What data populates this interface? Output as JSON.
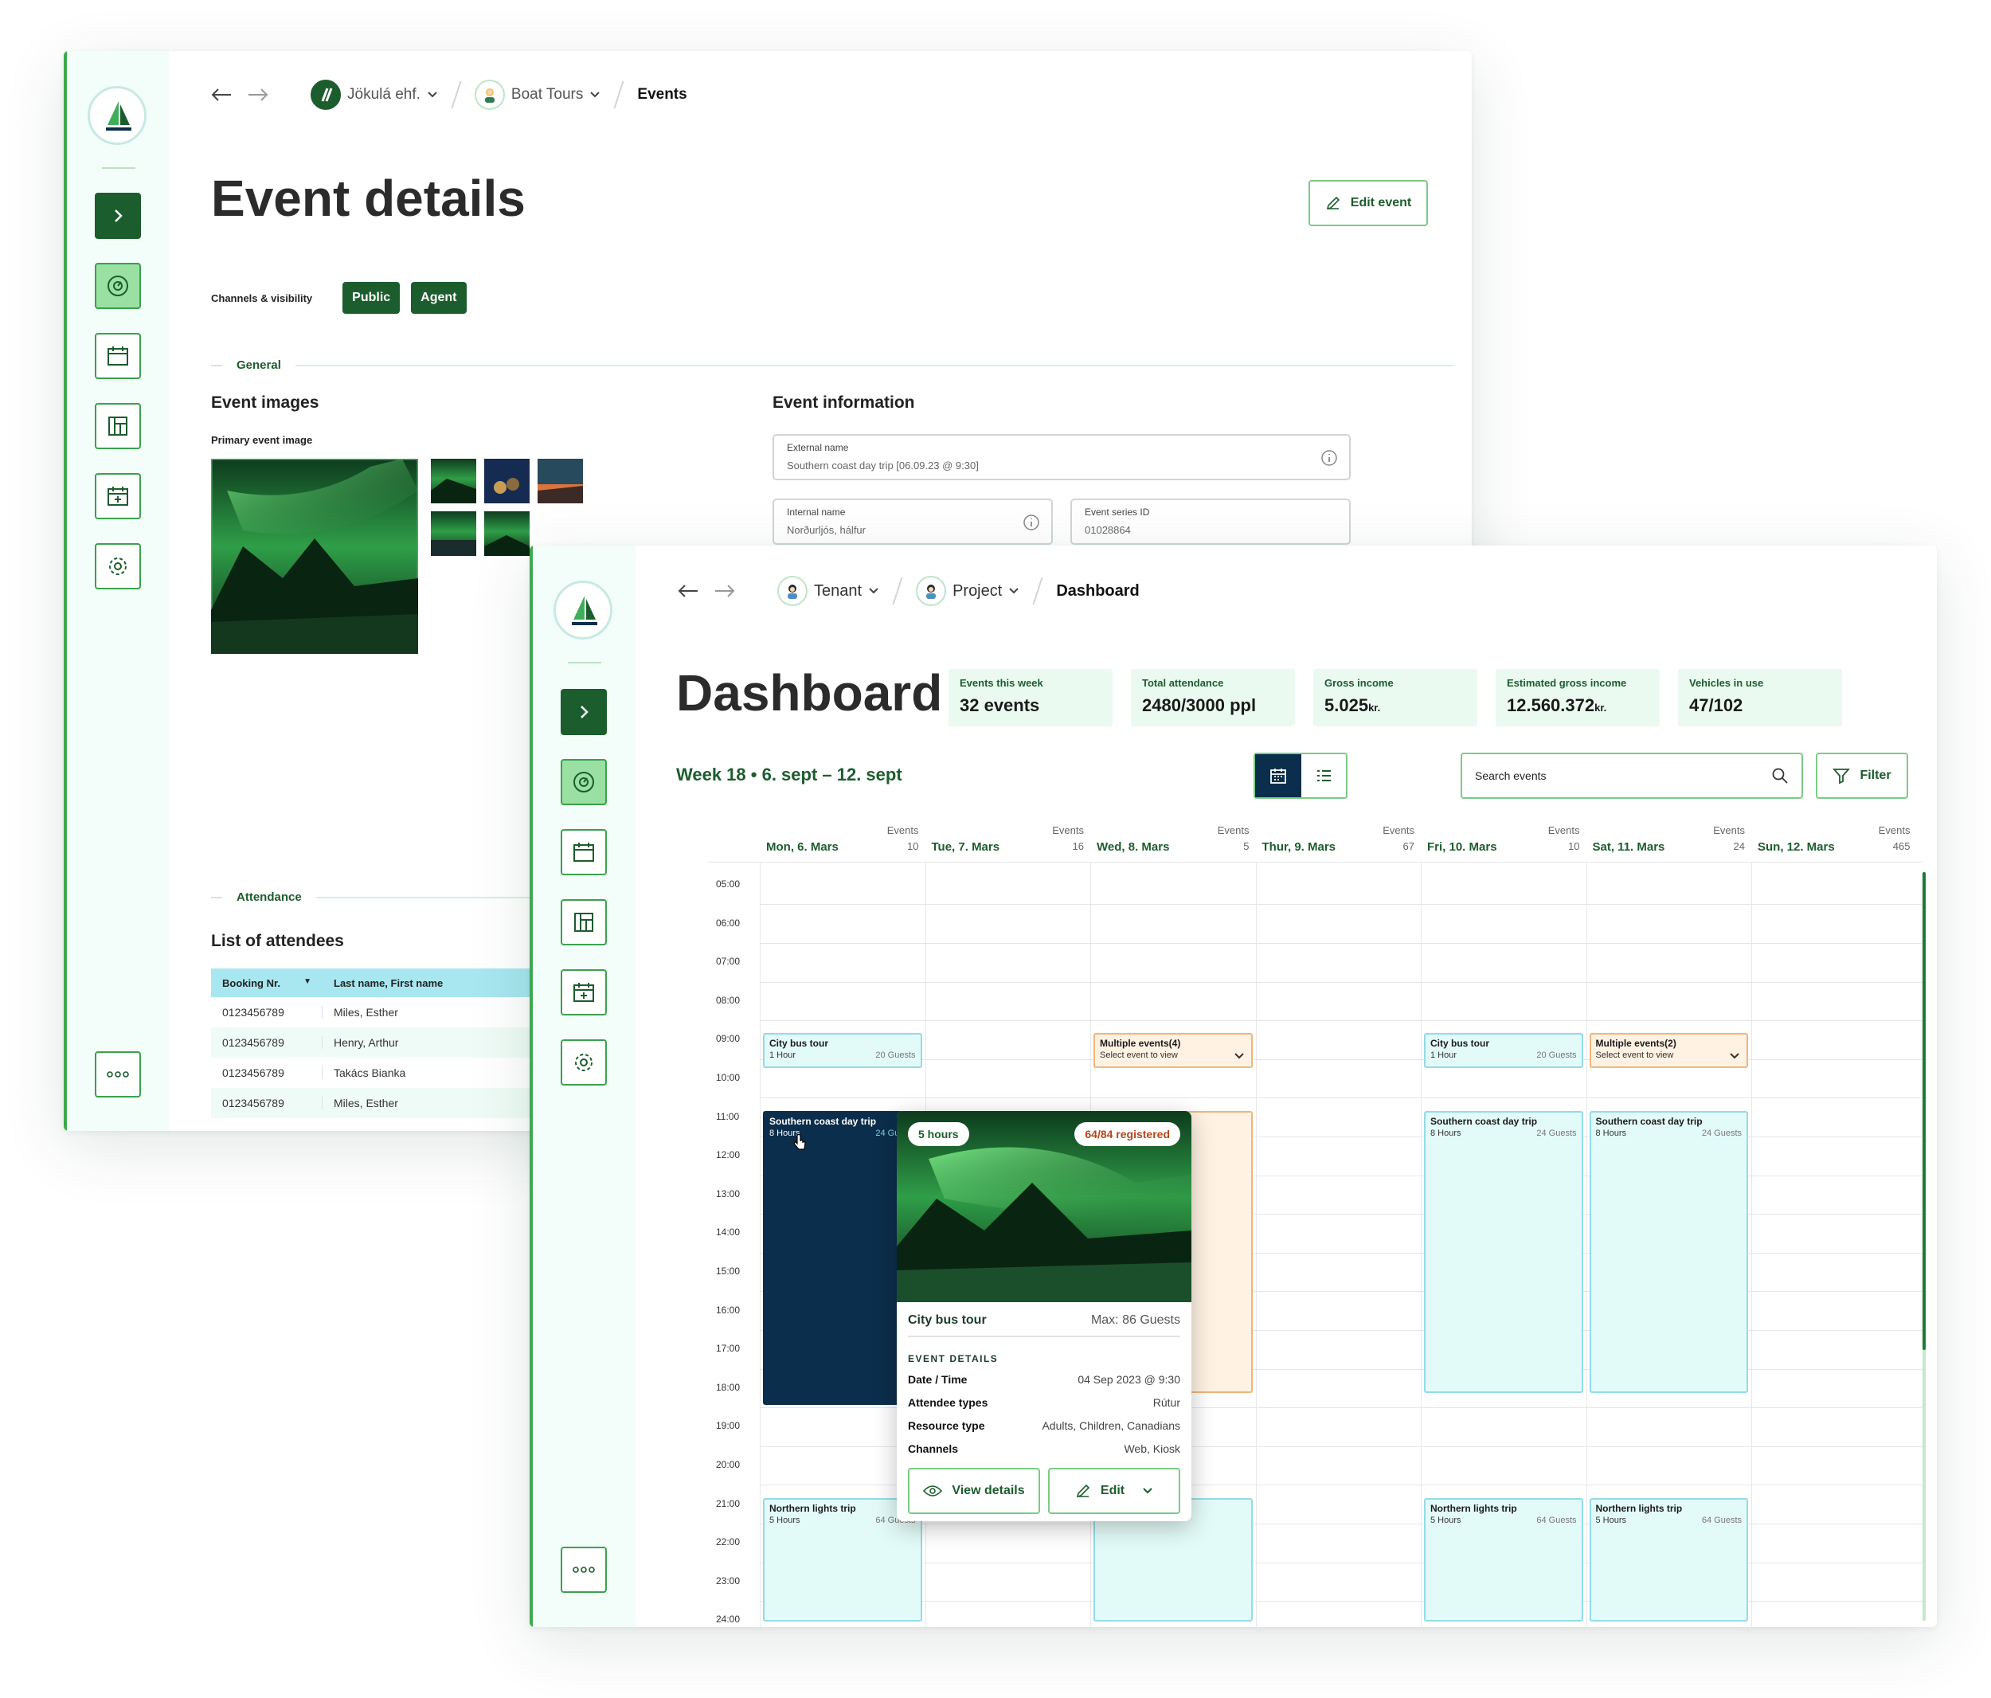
{
  "event_window": {
    "breadcrumb": {
      "company": "Jökulá ehf.",
      "project": "Boat Tours",
      "current": "Events"
    },
    "title": "Event details",
    "edit_button": "Edit event",
    "channels_label": "Channels & visibility",
    "channels": [
      "Public",
      "Agent"
    ],
    "general_label": "General",
    "images_heading": "Event images",
    "primary_image_label": "Primary event image",
    "info_heading": "Event information",
    "external_name": {
      "label": "External name",
      "value": "Southern coast day trip [06.09.23 @ 9:30]"
    },
    "internal_name": {
      "label": "Internal name",
      "value": "Norðurljós, hálfur"
    },
    "series_id": {
      "label": "Event series ID",
      "value": "01028864"
    },
    "attendance_label": "Attendance",
    "attendees_heading": "List of attendees",
    "attendees_columns": [
      "Booking Nr.",
      "Last name, First name"
    ],
    "attendees": [
      {
        "booking": "0123456789",
        "name": "Miles, Esther"
      },
      {
        "booking": "0123456789",
        "name": "Henry, Arthur"
      },
      {
        "booking": "0123456789",
        "name": "Takács Bianka"
      },
      {
        "booking": "0123456789",
        "name": "Miles, Esther"
      }
    ]
  },
  "dashboard": {
    "breadcrumb": {
      "tenant": "Tenant",
      "project": "Project",
      "current": "Dashboard"
    },
    "title": "Dashboard",
    "stats": [
      {
        "label": "Events this week",
        "value": "32 events",
        "unit": ""
      },
      {
        "label": "Total attendance",
        "value": "2480/3000 ppl",
        "unit": ""
      },
      {
        "label": "Gross income",
        "value": "5.025",
        "unit": "kr."
      },
      {
        "label": "Estimated gross income",
        "value": "12.560.372",
        "unit": "kr."
      },
      {
        "label": "Vehicles in use",
        "value": "47/102",
        "unit": ""
      }
    ],
    "week_label": "Week 18 • 6. sept – 12. sept",
    "search_placeholder": "Search events",
    "filter_label": "Filter",
    "events_word": "Events",
    "days": [
      {
        "name": "Mon, 6. Mars",
        "count": "10"
      },
      {
        "name": "Tue, 7. Mars",
        "count": "16"
      },
      {
        "name": "Wed, 8. Mars",
        "count": "5"
      },
      {
        "name": "Thur, 9. Mars",
        "count": "67"
      },
      {
        "name": "Fri, 10. Mars",
        "count": "10"
      },
      {
        "name": "Sat, 11. Mars",
        "count": "24"
      },
      {
        "name": "Sun, 12. Mars",
        "count": "465"
      }
    ],
    "times": [
      "05:00",
      "06:00",
      "07:00",
      "08:00",
      "09:00",
      "10:00",
      "11:00",
      "12:00",
      "13:00",
      "14:00",
      "15:00",
      "16:00",
      "17:00",
      "18:00",
      "19:00",
      "20:00",
      "21:00",
      "22:00",
      "23:00",
      "24:00"
    ],
    "events": [
      {
        "day": 0,
        "start": 9,
        "end": 9.9,
        "title": "City bus tour",
        "dur": "1 Hour",
        "guests": "20 Guests",
        "style": "cyan"
      },
      {
        "day": 2,
        "start": 9,
        "end": 9.9,
        "title": "Multiple events(4)",
        "dur": "Select event to view",
        "guests": "",
        "style": "orange"
      },
      {
        "day": 4,
        "start": 9,
        "end": 9.9,
        "title": "City bus tour",
        "dur": "1 Hour",
        "guests": "20 Guests",
        "style": "cyan"
      },
      {
        "day": 5,
        "start": 9,
        "end": 9.9,
        "title": "Multiple events(2)",
        "dur": "Select event to view",
        "guests": "",
        "style": "orange"
      },
      {
        "day": 0,
        "start": 11,
        "end": 18.6,
        "title": "Southern coast day trip",
        "dur": "8 Hours",
        "guests": "24 Guests",
        "style": "dark"
      },
      {
        "day": 2,
        "start": 11,
        "end": 18.3,
        "title": "",
        "dur": "",
        "guests": "",
        "style": "orange"
      },
      {
        "day": 4,
        "start": 11,
        "end": 18.3,
        "title": "Southern coast day trip",
        "dur": "8 Hours",
        "guests": "24 Guests",
        "style": "cyan"
      },
      {
        "day": 5,
        "start": 11,
        "end": 18.3,
        "title": "Southern coast day trip",
        "dur": "8 Hours",
        "guests": "24 Guests",
        "style": "cyan"
      },
      {
        "day": 0,
        "start": 21,
        "end": 24.2,
        "title": "Northern lights trip",
        "dur": "5 Hours",
        "guests": "64 Guests",
        "style": "cyan"
      },
      {
        "day": 2,
        "start": 21,
        "end": 24.2,
        "title": "",
        "dur": "",
        "guests": "",
        "style": "cyan"
      },
      {
        "day": 4,
        "start": 21,
        "end": 24.2,
        "title": "Northern lights trip",
        "dur": "5 Hours",
        "guests": "64 Guests",
        "style": "cyan"
      },
      {
        "day": 5,
        "start": 21,
        "end": 24.2,
        "title": "Northern lights trip",
        "dur": "5 Hours",
        "guests": "64 Guests",
        "style": "cyan"
      }
    ],
    "popup": {
      "duration": "5 hours",
      "registered": "64/84 registered",
      "title": "City bus tour",
      "max": "Max: 86 Guests",
      "section": "EVENT DETAILS",
      "rows": [
        {
          "k": "Date / Time",
          "v": "04 Sep 2023 @ 9:30"
        },
        {
          "k": "Attendee types",
          "v": "Rútur"
        },
        {
          "k": "Resource type",
          "v": "Adults, Children, Canadians"
        },
        {
          "k": "Channels",
          "v": "Web, Kiosk"
        }
      ],
      "view_button": "View details",
      "edit_button": "Edit"
    }
  },
  "colors": {
    "accent": "#1c5d2d",
    "sidebar": "#f3fdf9",
    "event_cyan": "#e3fbf8",
    "event_orange": "#fff2e3",
    "event_dark": "#0b2e4c"
  }
}
